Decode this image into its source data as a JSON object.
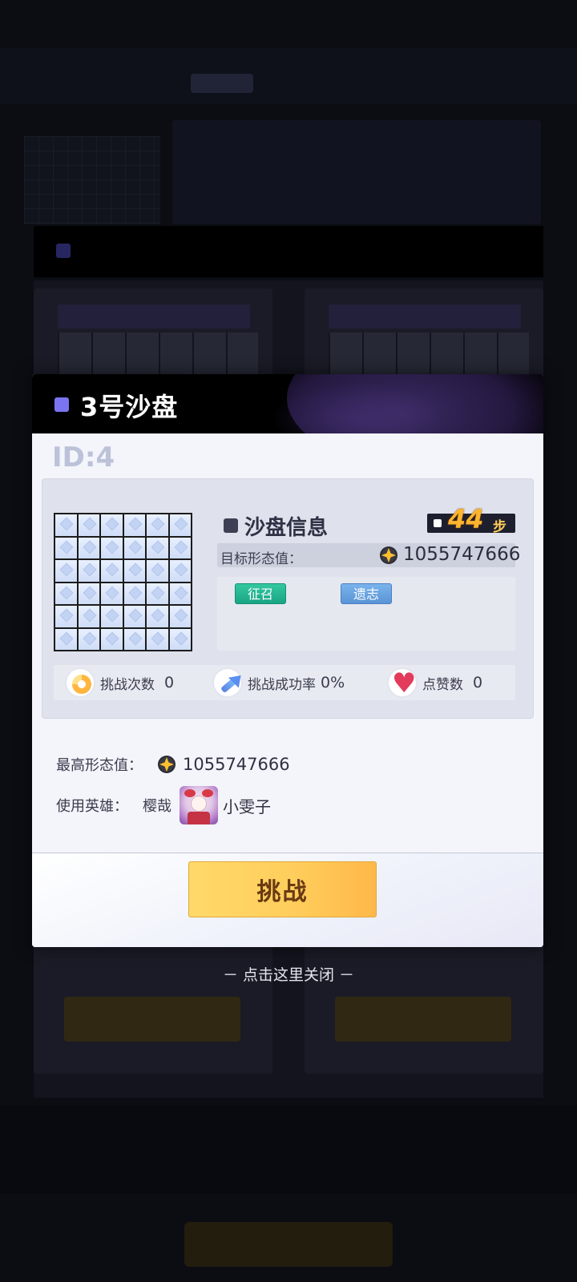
{
  "dialog": {
    "title": "3号沙盘",
    "id_label": "ID:4",
    "section_title": "沙盘信息",
    "steps_value": "44",
    "steps_unit": "步",
    "target_label": "目标形态值：",
    "target_value": "1055747666",
    "tags": [
      "征召",
      "遗志"
    ],
    "stats": [
      {
        "label": "挑战次数",
        "value": "0"
      },
      {
        "label": "挑战成功率",
        "value": "0%"
      },
      {
        "label": "点赞数",
        "value": "0"
      }
    ],
    "best_label": "最高形态值：",
    "best_value": "1055747666",
    "hero_label": "使用英雄：",
    "hero_name": "樱哉",
    "hero_nick": "小雯子",
    "challenge_button": "挑战"
  },
  "close_hint": "－ 点击这里关闭 －",
  "colors": {
    "accent_purple": "#7b74f0",
    "button_yellow": "#ffd96a",
    "tag_green": "#1aa585",
    "tag_blue": "#5a94d6",
    "steps_orange": "#ffb52e"
  },
  "icons": {
    "coin": "coin-icon",
    "attempts": "pie-chart-icon",
    "success_rate": "arrow-up-icon",
    "likes": "heart-icon"
  }
}
